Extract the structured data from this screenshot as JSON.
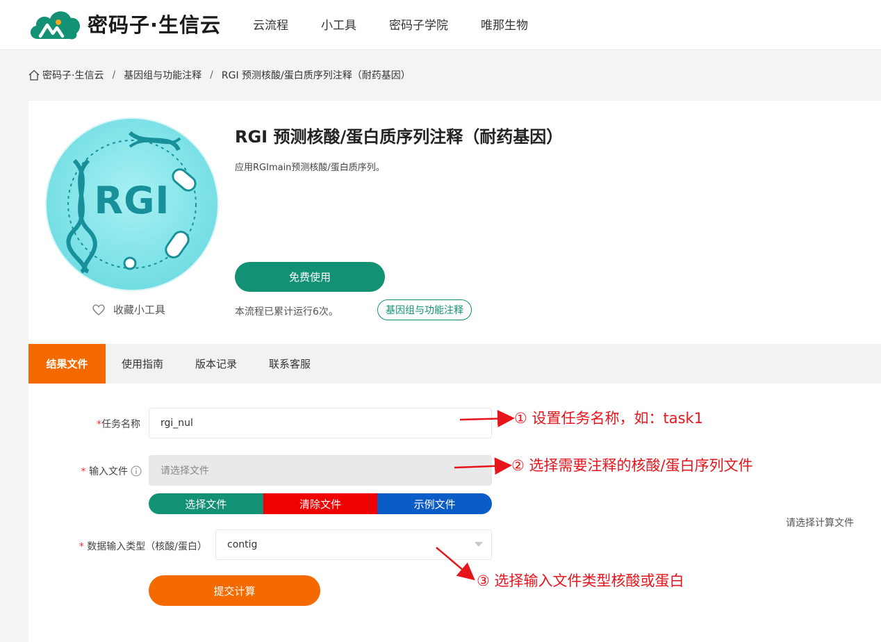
{
  "brand": {
    "name": "密码子·生信云",
    "colors": {
      "primary": "#139174",
      "accent": "#f56a00",
      "danger": "#f00000",
      "link": "#0b5cc6",
      "annotation": "#e8141b"
    }
  },
  "nav": {
    "items": [
      "云流程",
      "小工具",
      "密码子学院",
      "唯那生物"
    ]
  },
  "breadcrumb": {
    "home": "密码子·生信云",
    "separator": "/",
    "category": "基因组与功能注释",
    "current": "RGI 预测核酸/蛋白质序列注释（耐药基因）"
  },
  "tool": {
    "logo_text": "RGI",
    "title": "RGI 预测核酸/蛋白质序列注释（耐药基因）",
    "description": "应用RGImain预测核酸/蛋白质序列。",
    "free_button": "免费使用",
    "favorite_label": "收藏小工具",
    "run_count_text": "本流程已累计运行6次。",
    "category_tag": "基因组与功能注释"
  },
  "tabs": [
    {
      "label": "结果文件",
      "active": true
    },
    {
      "label": "使用指南",
      "active": false
    },
    {
      "label": "版本记录",
      "active": false
    },
    {
      "label": "联系客服",
      "active": false
    }
  ],
  "form": {
    "task_name": {
      "required_mark": "*",
      "label": "任务名称",
      "value": "rgi_nul"
    },
    "input_file": {
      "required_mark": "*",
      "label": "输入文件",
      "placeholder": "请选择文件",
      "info_icon": "info-icon"
    },
    "file_buttons": {
      "select": "选择文件",
      "clear": "清除文件",
      "example": "示例文件"
    },
    "data_type": {
      "required_mark": "*",
      "label": "数据输入类型（核酸/蛋白）",
      "value": "contig"
    },
    "right_hint": "请选择计算文件",
    "submit": "提交计算"
  },
  "annotations": [
    "① 设置任务名称，如：task1",
    "② 选择需要注释的核酸/蛋白序列文件",
    "③ 选择输入文件类型核酸或蛋白"
  ]
}
